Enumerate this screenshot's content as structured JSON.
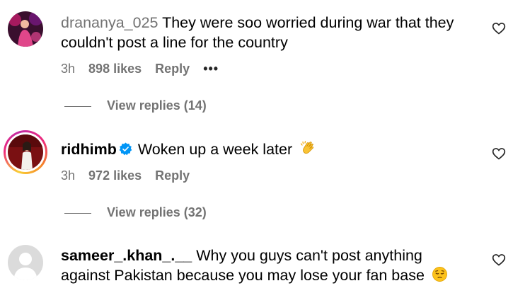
{
  "comments": [
    {
      "username": "drananya_025",
      "text": "They were soo worried during war that they couldn't post a line for the country",
      "time": "3h",
      "likes": "898 likes",
      "reply_label": "Reply",
      "more_label": "•••",
      "view_replies": "View replies (14)"
    },
    {
      "username": "ridhimb",
      "verified": true,
      "text": "Woken up a week later",
      "emoji": "clapping-hands-icon",
      "time": "3h",
      "likes": "972 likes",
      "reply_label": "Reply",
      "view_replies": "View replies (32)"
    },
    {
      "username": "sameer_.khan_.__",
      "text": "Why you guys can't post anything against Pakistan because you may lose your fan base",
      "emoji": "pensive-face-icon"
    }
  ],
  "colors": {
    "muted": "#737373",
    "verified_blue": "#0095f6",
    "story_ring": "#ee2a7b"
  }
}
